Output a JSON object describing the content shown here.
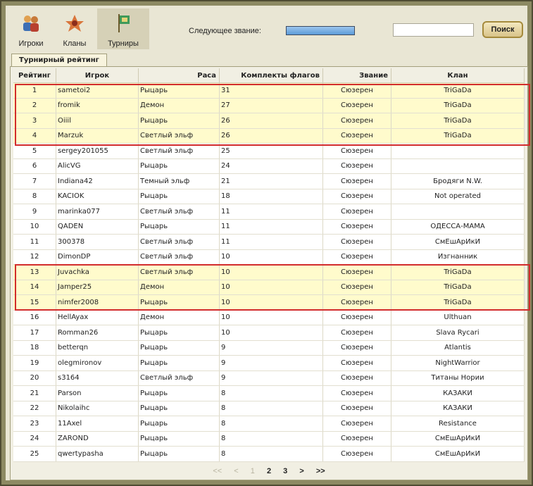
{
  "nav": [
    {
      "label": "Игроки",
      "icon": "players-icon",
      "active": false
    },
    {
      "label": "Кланы",
      "icon": "clans-icon",
      "active": false
    },
    {
      "label": "Турниры",
      "icon": "tournaments-icon",
      "active": true
    }
  ],
  "header": {
    "rank_label": "Следующее звание:",
    "rank_progress": 1.0,
    "search_placeholder": "",
    "search_button": "Поиск"
  },
  "tab": {
    "label": "Турнирный рейтинг"
  },
  "table": {
    "headers": [
      "Рейтинг",
      "Игрок",
      "Раса",
      "Комплекты флагов",
      "Звание",
      "Клан"
    ],
    "rows": [
      [
        "1",
        "sametoi2",
        "Рыцарь",
        "31",
        "Сюзерен",
        "TriGaDa"
      ],
      [
        "2",
        "fromik",
        "Демон",
        "27",
        "Сюзерен",
        "TriGaDa"
      ],
      [
        "3",
        "Oiiil",
        "Рыцарь",
        "26",
        "Сюзерен",
        "TriGaDa"
      ],
      [
        "4",
        "Marzuk",
        "Светлый эльф",
        "26",
        "Сюзерен",
        "TriGaDa"
      ],
      [
        "5",
        "sergey201055",
        "Светлый эльф",
        "25",
        "Сюзерен",
        ""
      ],
      [
        "6",
        "AlicVG",
        "Рыцарь",
        "24",
        "Сюзерен",
        ""
      ],
      [
        "7",
        "Indiana42",
        "Темный эльф",
        "21",
        "Сюзерен",
        "Бродяги N.W."
      ],
      [
        "8",
        "KACIOK",
        "Рыцарь",
        "18",
        "Сюзерен",
        "Not operated"
      ],
      [
        "9",
        "marinka077",
        "Светлый эльф",
        "11",
        "Сюзерен",
        ""
      ],
      [
        "10",
        "QADEN",
        "Рыцарь",
        "11",
        "Сюзерен",
        "ОДЕССА-МАМА"
      ],
      [
        "11",
        "300378",
        "Светлый эльф",
        "11",
        "Сюзерен",
        "СмЕшАрИкИ"
      ],
      [
        "12",
        "DimonDP",
        "Светлый эльф",
        "10",
        "Сюзерен",
        "Изгнанник"
      ],
      [
        "13",
        "Juvachka",
        "Светлый эльф",
        "10",
        "Сюзерен",
        "TriGaDa"
      ],
      [
        "14",
        "Jamper25",
        "Демон",
        "10",
        "Сюзерен",
        "TriGaDa"
      ],
      [
        "15",
        "nimfer2008",
        "Рыцарь",
        "10",
        "Сюзерен",
        "TriGaDa"
      ],
      [
        "16",
        "HellAyax",
        "Демон",
        "10",
        "Сюзерен",
        "Ulthuan"
      ],
      [
        "17",
        "Romman26",
        "Рыцарь",
        "10",
        "Сюзерен",
        "Slava Rycari"
      ],
      [
        "18",
        "betterqn",
        "Рыцарь",
        "9",
        "Сюзерен",
        "Atlantis"
      ],
      [
        "19",
        "olegmironov",
        "Рыцарь",
        "9",
        "Сюзерен",
        "NightWarrior"
      ],
      [
        "20",
        "s3164",
        "Светлый эльф",
        "9",
        "Сюзерен",
        "Титаны Нории"
      ],
      [
        "21",
        "Parson",
        "Рыцарь",
        "8",
        "Сюзерен",
        "КАЗАКИ"
      ],
      [
        "22",
        "Nikolaihc",
        "Рыцарь",
        "8",
        "Сюзерен",
        "КАЗАКИ"
      ],
      [
        "23",
        "11Axel",
        "Рыцарь",
        "8",
        "Сюзерен",
        "Resistance"
      ],
      [
        "24",
        "ZAROND",
        "Рыцарь",
        "8",
        "Сюзерен",
        "СмЕшАрИкИ"
      ],
      [
        "25",
        "qwertypasha",
        "Рыцарь",
        "8",
        "Сюзерен",
        "СмЕшАрИкИ"
      ]
    ],
    "highlighted_rows": [
      1,
      2,
      3,
      4,
      13,
      14,
      15
    ]
  },
  "pager": {
    "first": "<<",
    "prev": "<",
    "pages": [
      "1",
      "2",
      "3"
    ],
    "current": "1",
    "next": ">",
    "last": ">>"
  },
  "colors": {
    "highlight": "#fffbcc",
    "group_border": "#d22c2c",
    "rank_bar": "#5c9bd8"
  }
}
